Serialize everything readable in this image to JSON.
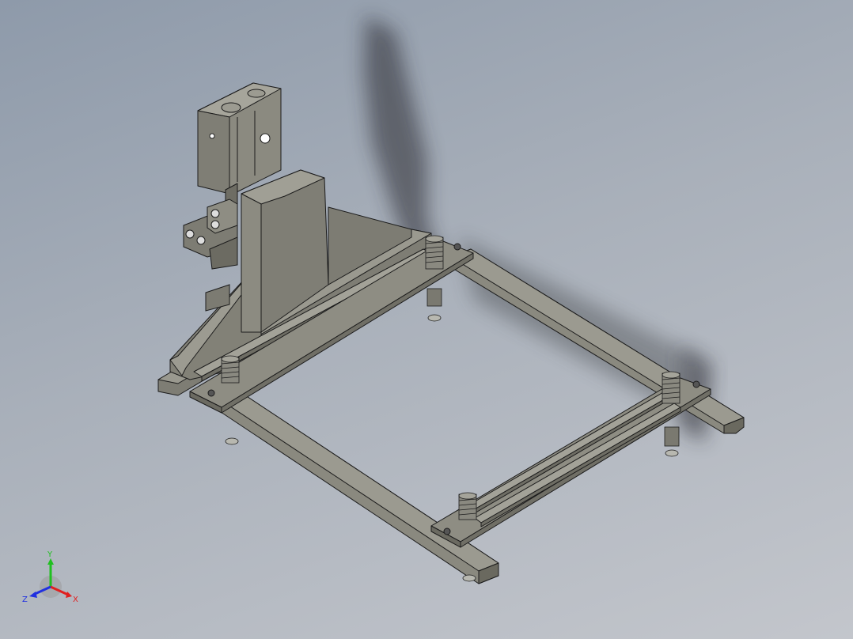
{
  "viewport": {
    "background_top": "#8e9aaa",
    "background_bottom": "#c3c6cc",
    "model_color": "#807f76",
    "edge_color": "#1c1c1c"
  },
  "triad": {
    "x_label": "X",
    "y_label": "Y",
    "z_label": "Z",
    "x_color": "#e02020",
    "y_color": "#20c020",
    "z_color": "#2030e0"
  }
}
